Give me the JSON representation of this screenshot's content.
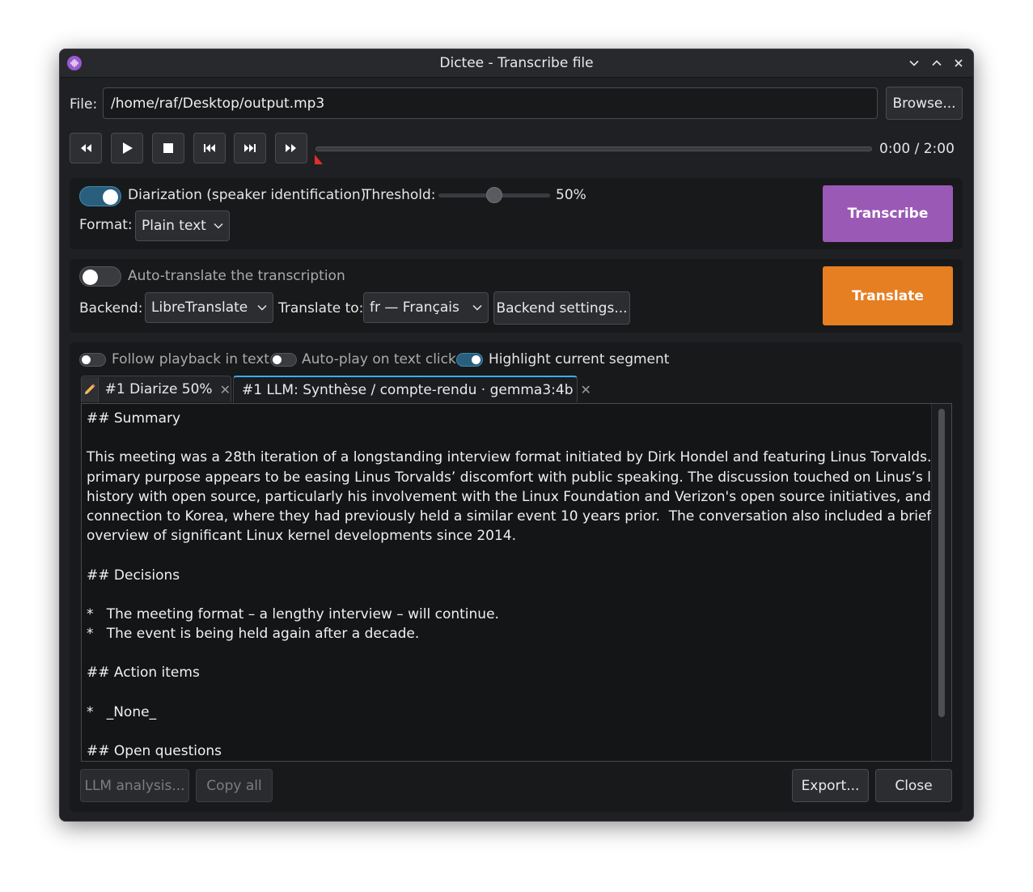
{
  "window": {
    "title": "Dictee - Transcribe file"
  },
  "file": {
    "label": "File:",
    "path": "/home/raf/Desktop/output.mp3",
    "browse_label": "Browse..."
  },
  "player": {
    "time": "0:00 / 2:00",
    "progress": 0
  },
  "diarization": {
    "label": "Diarization (speaker identification)",
    "enabled": true,
    "threshold_label": "Threshold:",
    "threshold_value": "50%",
    "threshold": 0.5,
    "format_label": "Format:",
    "format_value": "Plain text",
    "transcribe_label": "Transcribe",
    "transcribe_color": "#9b59b6"
  },
  "translation": {
    "auto_label": "Auto-translate the transcription",
    "enabled": false,
    "backend_label": "Backend:",
    "backend_value": "LibreTranslate",
    "translate_to_label": "Translate to:",
    "translate_to_value": "fr — Français",
    "backend_settings_label": "Backend settings...",
    "translate_label": "Translate",
    "translate_color": "#e67e22"
  },
  "options": {
    "follow_playback": "Follow playback in text",
    "auto_play": "Auto-play on text click",
    "highlight": "Highlight current segment"
  },
  "tabs": [
    {
      "label": "#1 Diarize 50%",
      "icon": "pencil-icon"
    },
    {
      "label": "#1 LLM: Synthèse / compte-rendu · gemma3:4b"
    }
  ],
  "text_lines": [
    "## Summary",
    "",
    "This meeting was a 28th iteration of a longstanding interview format initiated by Dirk Hondel and featuring Linus Torvalds. The",
    "primary purpose appears to be easing Linus Torvalds’ discomfort with public speaking. The discussion touched on Linus’s long",
    "history with open source, particularly his involvement with the Linux Foundation and Verizon's open source initiatives, and his",
    "connection to Korea, where they had previously held a similar event 10 years prior.  The conversation also included a brief",
    "overview of significant Linux kernel developments since 2014.",
    "",
    "## Decisions",
    "",
    "*   The meeting format – a lengthy interview – will continue.",
    "*   The event is being held again after a decade.",
    "",
    "## Action items",
    "",
    "*   _None_",
    "",
    "## Open questions"
  ],
  "footer": {
    "llm_label": "LLM analysis...",
    "copy_label": "Copy all",
    "export_label": "Export...",
    "close_label": "Close"
  },
  "colors": {
    "accent": "#3daee9",
    "background": "#1f2023",
    "panel": "#18191b"
  }
}
